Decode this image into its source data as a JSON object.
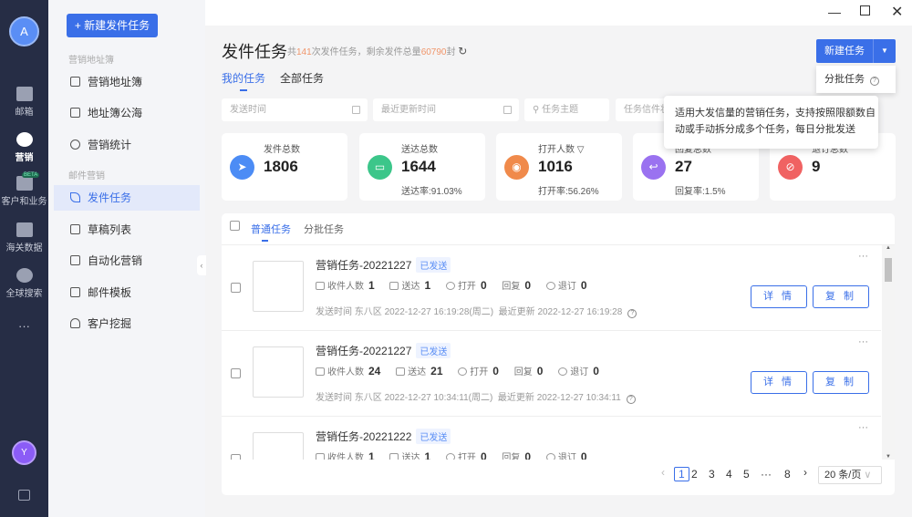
{
  "user_avatar": "A",
  "bottom_avatar": "Y",
  "nav": [
    {
      "label": "邮箱"
    },
    {
      "label": "营销"
    },
    {
      "label": "客户和业务",
      "badge": "BETA"
    },
    {
      "label": "海关数据"
    },
    {
      "label": "全球搜索"
    },
    {
      "label": "···"
    }
  ],
  "sidebar": {
    "new_button": "+ 新建发件任务",
    "group1": "营销地址簿",
    "group2": "邮件营销",
    "items": [
      "营销地址簿",
      "地址簿公海",
      "营销统计",
      "发件任务",
      "草稿列表",
      "自动化营销",
      "邮件模板",
      "客户挖掘"
    ]
  },
  "header": {
    "title": "发件任务",
    "summary_prefix": "共",
    "task_count": "141",
    "summary_mid": "次发件任务，剩余发件总量",
    "remaining": "60790",
    "summary_suffix": "封",
    "tabs": [
      "我的任务",
      "全部任务"
    ],
    "new_task": "新建任务",
    "dropdown_item": "分批任务",
    "tooltip": "适用大发信量的营销任务，支持按照限额数自动或手动拆分成多个任务，每日分批发送"
  },
  "filters": {
    "send_time": "发送时间",
    "update_time": "最近更新时间",
    "subject": "任务主题",
    "sender": "任务信件状"
  },
  "stats": [
    {
      "label": "发件总数",
      "value": "1806",
      "rate": "",
      "color": "#4c8cf5"
    },
    {
      "label": "送达总数",
      "value": "1644",
      "rate": "送达率:91.03%",
      "color": "#3cc68a"
    },
    {
      "label": "打开人数",
      "value": "1016",
      "rate": "打开率:56.26%",
      "color": "#f08a4b"
    },
    {
      "label": "回复总数",
      "value": "27",
      "rate": "回复率:1.5%",
      "color": "#9a72f0"
    },
    {
      "label": "退订总数",
      "value": "9",
      "rate": "",
      "color": "#f06262"
    }
  ],
  "list_tabs": [
    "普通任务",
    "分批任务"
  ],
  "metric_labels": {
    "recipients": "收件人数",
    "delivered": "送达",
    "opened": "打开",
    "replied": "回复",
    "unsub": "退订",
    "send_time": "发送时间",
    "tz": "东八区",
    "updated": "最近更新",
    "detail": "详 情",
    "copy": "复 制"
  },
  "tasks": [
    {
      "name": "营销任务-20221227",
      "status": "已发送",
      "recipients": "1",
      "delivered": "1",
      "opened": "0",
      "replied": "0",
      "unsub": "0",
      "send_time": "2022-12-27 16:19:28(周二)",
      "updated": "2022-12-27 16:19:28"
    },
    {
      "name": "营销任务-20221227",
      "status": "已发送",
      "recipients": "24",
      "delivered": "21",
      "opened": "0",
      "replied": "0",
      "unsub": "0",
      "send_time": "2022-12-27 10:34:11(周二)",
      "updated": "2022-12-27 10:34:11"
    },
    {
      "name": "营销任务-20221222",
      "status": "已发送",
      "recipients": "1",
      "delivered": "1",
      "opened": "0",
      "replied": "0",
      "unsub": "0",
      "send_time": "",
      "updated": ""
    }
  ],
  "pagination": {
    "pages": [
      "1",
      "2",
      "3",
      "4",
      "5",
      "···",
      "8"
    ],
    "page_size": "20 条/页"
  }
}
